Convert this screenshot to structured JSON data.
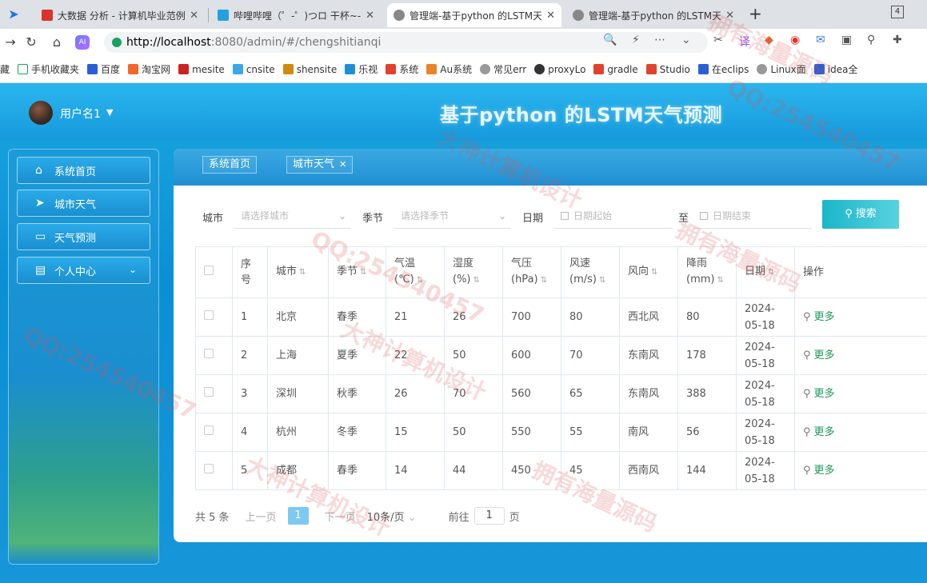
{
  "browser": {
    "tabs": [
      {
        "title": "大数据 分析 - 计算机毕业范例",
        "close": "✕",
        "color": "#d8342b"
      },
      {
        "title": "哔哩哔哩（゜-゜)つロ 干杯~-b",
        "close": "✕",
        "color": "#21a1e0"
      },
      {
        "title": "管理端-基于python 的LSTM天",
        "close": "✕",
        "color": "#888888"
      },
      {
        "title": "管理端-基于python 的LSTM天",
        "close": "✕",
        "color": "#888888"
      }
    ],
    "new_tab": "+",
    "tab_count": "4",
    "url_host": "http://localhost",
    "url_rest": ":8080/admin/#/chengshitianqi",
    "bookmarks": [
      "藏",
      "手机收藏夹",
      "百度",
      "淘宝网",
      "mesite",
      "cnsite",
      "shensite",
      "乐视",
      "系统",
      "Au系统",
      "常见err",
      "proxyLo",
      "gradle",
      "Studio",
      "在eclips",
      "Linux面",
      "idea全"
    ]
  },
  "header": {
    "username": "用户名1",
    "title": "基于python 的LSTM天气预测"
  },
  "sidebar": {
    "items": [
      {
        "label": "系统首页",
        "icon": "home-icon"
      },
      {
        "label": "城市天气",
        "icon": "send-icon"
      },
      {
        "label": "天气预测",
        "icon": "wallet-icon"
      },
      {
        "label": "个人中心",
        "icon": "card-icon"
      }
    ]
  },
  "breadcrumbs": {
    "home": "系统首页",
    "current": "城市天气",
    "close": "✕"
  },
  "filters": {
    "city_label": "城市",
    "city_placeholder": "请选择城市",
    "season_label": "季节",
    "season_placeholder": "请选择季节",
    "date_label": "日期",
    "date_start_placeholder": "日期起始",
    "to_label": "至",
    "date_end_placeholder": "日期结束",
    "search_label": "搜索"
  },
  "table": {
    "headers": {
      "index": "序号",
      "city": "城市",
      "season": "季节",
      "temp": "气温(℃)",
      "humidity": "湿度(%)",
      "pressure": "气压(hPa)",
      "wind_speed": "风速(m/s)",
      "wind_dir": "风向",
      "rain": "降雨(mm)",
      "date": "日期",
      "action": "操作"
    },
    "more_label": "更多",
    "rows": [
      {
        "index": "1",
        "city": "北京",
        "season": "春季",
        "temp": "21",
        "humidity": "26",
        "pressure": "700",
        "wind_speed": "80",
        "wind_dir": "西北风",
        "rain": "80",
        "date": "2024-05-18"
      },
      {
        "index": "2",
        "city": "上海",
        "season": "夏季",
        "temp": "22",
        "humidity": "50",
        "pressure": "600",
        "wind_speed": "70",
        "wind_dir": "东南风",
        "rain": "178",
        "date": "2024-05-18"
      },
      {
        "index": "3",
        "city": "深圳",
        "season": "秋季",
        "temp": "26",
        "humidity": "70",
        "pressure": "560",
        "wind_speed": "65",
        "wind_dir": "东南风",
        "rain": "388",
        "date": "2024-05-18"
      },
      {
        "index": "4",
        "city": "杭州",
        "season": "冬季",
        "temp": "15",
        "humidity": "50",
        "pressure": "550",
        "wind_speed": "55",
        "wind_dir": "南风",
        "rain": "56",
        "date": "2024-05-18"
      },
      {
        "index": "5",
        "city": "成都",
        "season": "春季",
        "temp": "14",
        "humidity": "44",
        "pressure": "450",
        "wind_speed": "45",
        "wind_dir": "西南风",
        "rain": "144",
        "date": "2024-05-18"
      }
    ]
  },
  "pagination": {
    "total": "共 5 条",
    "prev": "上一页",
    "current": "1",
    "next": "下一页",
    "page_size": "10条/页",
    "goto": "前往",
    "goto_value": "1",
    "page_unit": "页"
  },
  "watermarks": {
    "a": "拥有海量源码",
    "b": "QQ:254540457",
    "c": "大神计算机设计"
  },
  "colors": {
    "accent": "#1a8fd0",
    "more_link": "#1a9a56",
    "search_button": "#1bb6c9"
  }
}
